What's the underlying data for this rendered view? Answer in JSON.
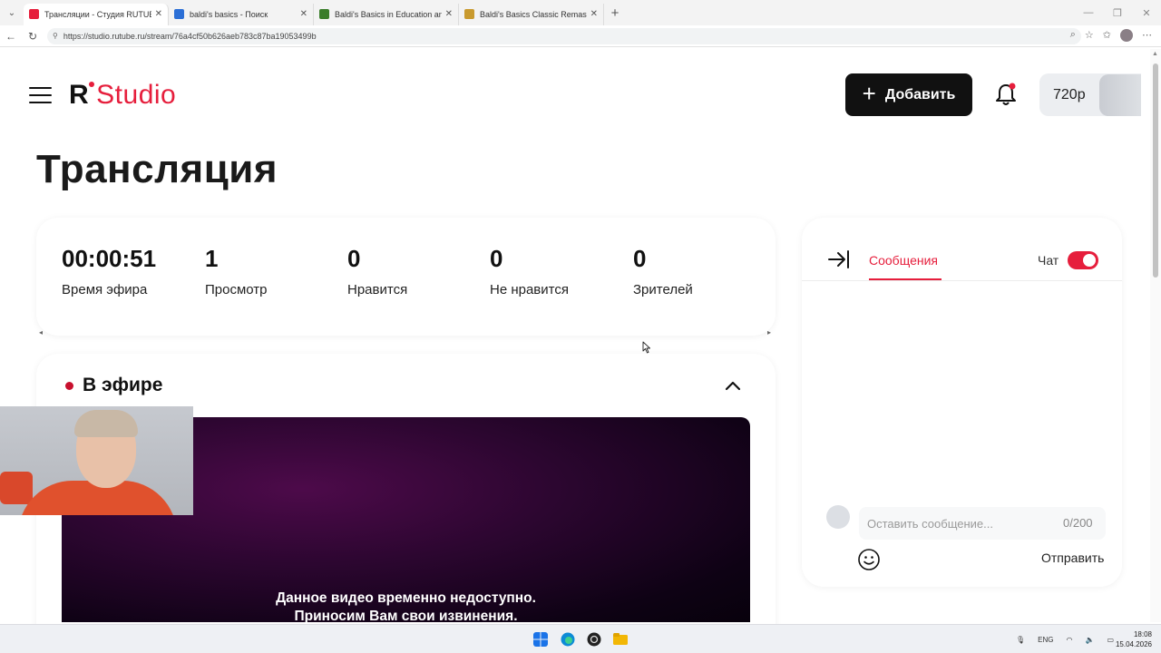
{
  "browser": {
    "tabs": [
      {
        "title": "Трансляции - Студия RUTUBE",
        "active": true,
        "favicon_color": "#e61e3c"
      },
      {
        "title": "baldi's basics - Поиск",
        "active": false,
        "favicon_color": "#2b6fd6"
      },
      {
        "title": "Baldi's Basics in Education and Le",
        "active": false,
        "favicon_color": "#3a7d2a"
      },
      {
        "title": "Baldi's Basics Classic Remastered |",
        "active": false,
        "favicon_color": "#c99a2e"
      }
    ],
    "url": "https://studio.rutube.ru/stream/76a4cf50b626aeb783c87ba19053499b"
  },
  "header": {
    "logo_r": "R",
    "logo_text": "Studio",
    "add_button_label": "Добавить",
    "quality_label": "720p"
  },
  "page": {
    "title": "Трансляция"
  },
  "stats": [
    {
      "value": "00:00:51",
      "label": "Время эфира"
    },
    {
      "value": "1",
      "label": "Просмотр"
    },
    {
      "value": "0",
      "label": "Нравится"
    },
    {
      "value": "0",
      "label": "Не нравится"
    },
    {
      "value": "0",
      "label": "Зрителей"
    }
  ],
  "live": {
    "label": "В эфире",
    "video_message_line1": "Данное видео временно недоступно.",
    "video_message_line2": "Приносим Вам свои извинения."
  },
  "chat": {
    "tab_label": "Сообщения",
    "toggle_label": "Чат",
    "toggle_on": true,
    "input_placeholder": "Оставить сообщение...",
    "counter": "0/200",
    "send_label": "Отправить"
  },
  "taskbar": {
    "language": "ENG",
    "time": "18:08",
    "date": "15.04.2026"
  },
  "colors": {
    "accent": "#e61e3c",
    "live_dot": "#c8102e",
    "button_dark": "#111111"
  }
}
